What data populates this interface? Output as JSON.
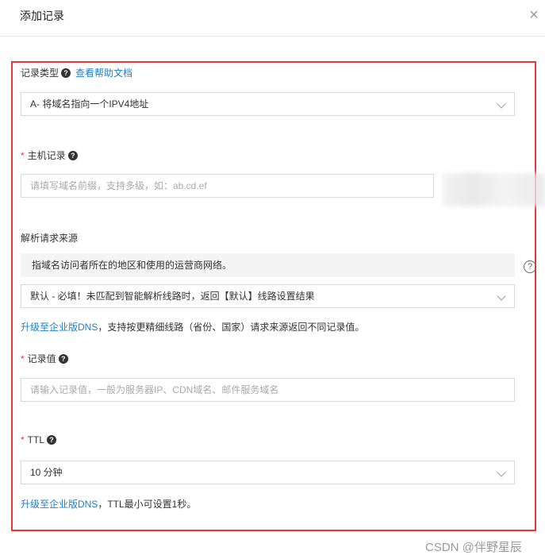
{
  "dialog": {
    "title": "添加记录",
    "close_glyph": "×"
  },
  "record_type": {
    "label": "记录类型",
    "help_glyph": "?",
    "help_link": "查看帮助文档",
    "selected": "A- 将域名指向一个IPV4地址"
  },
  "host_record": {
    "required_mark": "*",
    "label": "主机记录",
    "help_glyph": "?",
    "placeholder": "请填写域名前缀，支持多级，如：ab.cd.ef"
  },
  "resolve_source": {
    "label": "解析请求来源",
    "tip": "指域名访问者所在的地区和使用的运营商网络。",
    "tip_help_glyph": "?",
    "selected": "默认 - 必填！未匹配到智能解析线路时，返回【默认】线路设置结果",
    "upgrade_link": "升级至企业版DNS",
    "upgrade_note": "，支持按更精细线路（省份、国家）请求来源返回不同记录值。"
  },
  "record_value": {
    "required_mark": "*",
    "label": "记录值",
    "help_glyph": "?",
    "placeholder": "请输入记录值，一般为服务器IP、CDN域名、邮件服务域名"
  },
  "ttl": {
    "required_mark": "*",
    "label": "TTL",
    "help_glyph": "?",
    "selected": "10 分钟",
    "upgrade_link": "升级至企业版DNS",
    "upgrade_note": "，TTL最小可设置1秒。"
  },
  "watermark": "CSDN @伴野星辰",
  "colors": {
    "highlight": "#e53935",
    "link": "#1f7fc4",
    "required": "#e53935"
  }
}
